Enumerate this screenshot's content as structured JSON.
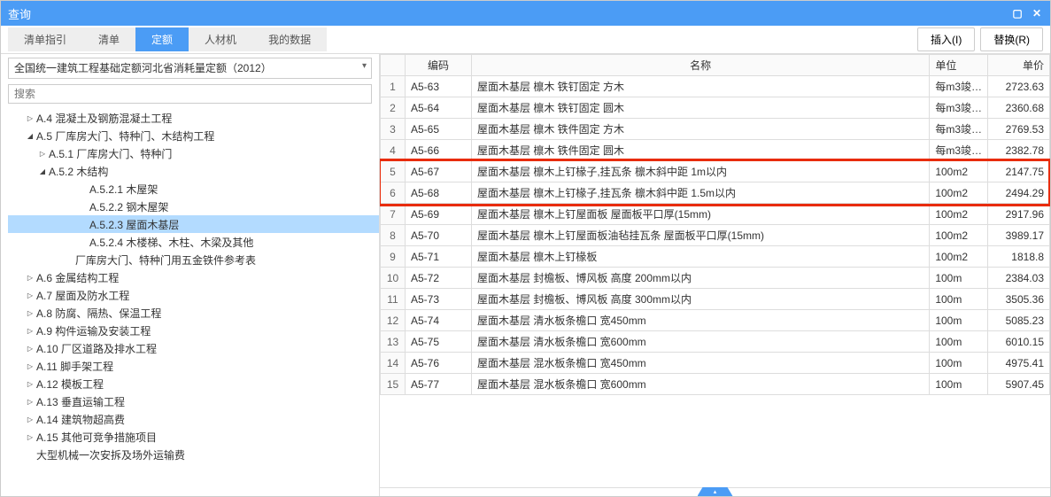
{
  "window": {
    "title": "查询"
  },
  "toolbar": {
    "tabs": [
      "清单指引",
      "清单",
      "定额",
      "人材机",
      "我的数据"
    ],
    "active_tab_index": 2,
    "insert_btn": "插入(I)",
    "replace_btn": "替换(R)"
  },
  "left": {
    "combo_value": "全国统一建筑工程基础定额河北省消耗量定额（2012）",
    "search_placeholder": "搜索",
    "tree": [
      {
        "level": 1,
        "exp": "▷",
        "label": "A.4 混凝土及钢筋混凝土工程"
      },
      {
        "level": 1,
        "exp": "◢",
        "label": "A.5 厂库房大门、特种门、木结构工程"
      },
      {
        "level": 2,
        "exp": "▷",
        "label": "A.5.1 厂库房大门、特种门"
      },
      {
        "level": 2,
        "exp": "◢",
        "label": "A.5.2 木结构"
      },
      {
        "level": 4,
        "exp": "",
        "label": "A.5.2.1 木屋架"
      },
      {
        "level": 4,
        "exp": "",
        "label": "A.5.2.2 钢木屋架"
      },
      {
        "level": 4,
        "exp": "",
        "label": "A.5.2.3 屋面木基层",
        "selected": true
      },
      {
        "level": 4,
        "exp": "",
        "label": "A.5.2.4 木楼梯、木柱、木梁及其他"
      },
      {
        "level": "3a",
        "exp": "",
        "label": "厂库房大门、特种门用五金铁件参考表"
      },
      {
        "level": 1,
        "exp": "▷",
        "label": "A.6 金属结构工程"
      },
      {
        "level": 1,
        "exp": "▷",
        "label": "A.7 屋面及防水工程"
      },
      {
        "level": 1,
        "exp": "▷",
        "label": "A.8 防腐、隔热、保温工程"
      },
      {
        "level": 1,
        "exp": "▷",
        "label": "A.9 构件运输及安装工程"
      },
      {
        "level": 1,
        "exp": "▷",
        "label": "A.10 厂区道路及排水工程"
      },
      {
        "level": 1,
        "exp": "▷",
        "label": "A.11 脚手架工程"
      },
      {
        "level": 1,
        "exp": "▷",
        "label": "A.12 模板工程"
      },
      {
        "level": 1,
        "exp": "▷",
        "label": "A.13 垂直运输工程"
      },
      {
        "level": 1,
        "exp": "▷",
        "label": "A.14 建筑物超高费"
      },
      {
        "level": 1,
        "exp": "▷",
        "label": "A.15 其他可竞争措施项目"
      },
      {
        "level": 1,
        "exp": "",
        "label": "大型机械一次安拆及场外运输费"
      }
    ]
  },
  "grid": {
    "headers": {
      "code": "编码",
      "name": "名称",
      "unit": "单位",
      "price": "单价"
    },
    "rows": [
      {
        "n": 1,
        "code": "A5-63",
        "name": "屋面木基层 檩木 铁钉固定 方木",
        "unit": "每m3竣…",
        "price": "2723.63"
      },
      {
        "n": 2,
        "code": "A5-64",
        "name": "屋面木基层 檩木 铁钉固定 圆木",
        "unit": "每m3竣…",
        "price": "2360.68"
      },
      {
        "n": 3,
        "code": "A5-65",
        "name": "屋面木基层 檩木 铁件固定 方木",
        "unit": "每m3竣…",
        "price": "2769.53"
      },
      {
        "n": 4,
        "code": "A5-66",
        "name": "屋面木基层 檩木 铁件固定 圆木",
        "unit": "每m3竣…",
        "price": "2382.78"
      },
      {
        "n": 5,
        "code": "A5-67",
        "name": "屋面木基层 檩木上钉椽子,挂瓦条 檩木斜中距 1m以内",
        "unit": "100m2",
        "price": "2147.75",
        "hl": true
      },
      {
        "n": 6,
        "code": "A5-68",
        "name": "屋面木基层 檩木上钉椽子,挂瓦条 檩木斜中距 1.5m以内",
        "unit": "100m2",
        "price": "2494.29",
        "hl": true
      },
      {
        "n": 7,
        "code": "A5-69",
        "name": "屋面木基层 檩木上钉屋面板 屋面板平口厚(15mm)",
        "unit": "100m2",
        "price": "2917.96"
      },
      {
        "n": 8,
        "code": "A5-70",
        "name": "屋面木基层 檩木上钉屋面板油毡挂瓦条 屋面板平口厚(15mm)",
        "unit": "100m2",
        "price": "3989.17"
      },
      {
        "n": 9,
        "code": "A5-71",
        "name": "屋面木基层 檩木上钉椽板",
        "unit": "100m2",
        "price": "1818.8"
      },
      {
        "n": 10,
        "code": "A5-72",
        "name": "屋面木基层 封檐板、博风板 高度 200mm以内",
        "unit": "100m",
        "price": "2384.03"
      },
      {
        "n": 11,
        "code": "A5-73",
        "name": "屋面木基层 封檐板、博风板 高度 300mm以内",
        "unit": "100m",
        "price": "3505.36"
      },
      {
        "n": 12,
        "code": "A5-74",
        "name": "屋面木基层 清水板条檐口 宽450mm",
        "unit": "100m",
        "price": "5085.23"
      },
      {
        "n": 13,
        "code": "A5-75",
        "name": "屋面木基层 清水板条檐口 宽600mm",
        "unit": "100m",
        "price": "6010.15"
      },
      {
        "n": 14,
        "code": "A5-76",
        "name": "屋面木基层 混水板条檐口 宽450mm",
        "unit": "100m",
        "price": "4975.41"
      },
      {
        "n": 15,
        "code": "A5-77",
        "name": "屋面木基层 混水板条檐口 宽600mm",
        "unit": "100m",
        "price": "5907.45"
      }
    ]
  }
}
